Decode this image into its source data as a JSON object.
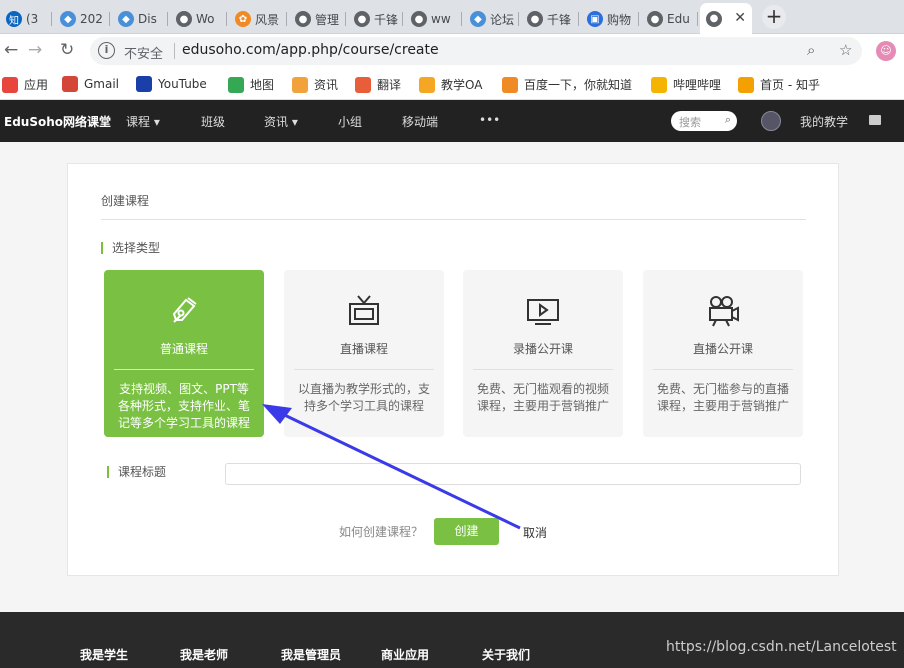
{
  "browser": {
    "tabs": [
      {
        "label": "(3 ",
        "icon": "zhihu-icon",
        "icon_text": "知",
        "color": "#0a66c2"
      },
      {
        "label": "202",
        "icon": "blog-icon",
        "icon_text": "◆",
        "color": "#4a90d9"
      },
      {
        "label": "Dis",
        "icon": "blog-icon",
        "icon_text": "◆",
        "color": "#4a90d9"
      },
      {
        "label": "Wo",
        "icon": "globe-icon",
        "icon_text": "●",
        "color": "#5f6368"
      },
      {
        "label": "风景",
        "icon": "paw-icon",
        "icon_text": "✿",
        "color": "#f08a24"
      },
      {
        "label": "管理",
        "icon": "globe-icon",
        "icon_text": "●",
        "color": "#5f6368"
      },
      {
        "label": "千锋",
        "icon": "globe-icon",
        "icon_text": "●",
        "color": "#5f6368"
      },
      {
        "label": "ww",
        "icon": "globe-icon",
        "icon_text": "●",
        "color": "#5f6368"
      },
      {
        "label": "论坛",
        "icon": "blog-icon",
        "icon_text": "◆",
        "color": "#4a90d9"
      },
      {
        "label": "千锋",
        "icon": "globe-icon",
        "icon_text": "●",
        "color": "#5f6368"
      },
      {
        "label": "购物",
        "icon": "cart-icon",
        "icon_text": "▣",
        "color": "#2a6fdb"
      },
      {
        "label": "Edu",
        "icon": "globe-icon",
        "icon_text": "●",
        "color": "#5f6368"
      },
      {
        "label": "",
        "icon": "globe-icon",
        "icon_text": "●",
        "color": "#5f6368",
        "active": true
      }
    ],
    "close_glyph": "✕",
    "newtab_glyph": "+",
    "back_glyph": "←",
    "forward_glyph": "→",
    "reload_glyph": "↻",
    "info_glyph": "i",
    "insecure": "不安全",
    "url": "edusoho.com/app.php/course/create",
    "zoom_glyph": "⌕",
    "star_glyph": "☆",
    "bookmarks": [
      {
        "label": "应用",
        "icon": "apps-icon",
        "color": "#e8453c"
      },
      {
        "label": "Gmail",
        "icon": "gmail-icon",
        "color": "#d44638"
      },
      {
        "label": "YouTube",
        "icon": "youtube-icon",
        "color": "#1a3fa8"
      },
      {
        "label": "地图",
        "icon": "maps-icon",
        "color": "#34a853"
      },
      {
        "label": "资讯",
        "icon": "news-icon",
        "color": "#f2a23a"
      },
      {
        "label": "翻译",
        "icon": "translate-icon",
        "color": "#e85d3a"
      },
      {
        "label": "教学OA",
        "icon": "oa-icon",
        "color": "#f5a623"
      },
      {
        "label": "百度一下，你就知道",
        "icon": "baidu-icon",
        "color": "#f08a24"
      },
      {
        "label": "哔哩哔哩",
        "icon": "bilibili-icon",
        "color": "#f4b400"
      },
      {
        "label": "首页 - 知乎",
        "icon": "zhihu-icon",
        "color": "#f4a000"
      }
    ]
  },
  "site": {
    "brand": "EduSoho网络课堂",
    "nav": [
      "课程 ▾",
      "班级",
      "资讯 ▾",
      "小组",
      "移动端",
      "•••"
    ],
    "search_placeholder": "搜索",
    "search_glyph": "⌕",
    "my_teaching": "我的教学"
  },
  "form": {
    "title": "创建课程",
    "type_label": "选择类型",
    "types": [
      {
        "name": "普通课程",
        "desc": "支持视频、图文、PPT等各种形式，支持作业、笔记等多个学习工具的课程",
        "selected": true
      },
      {
        "name": "直播课程",
        "desc": "以直播为教学形式的，支持多个学习工具的课程",
        "selected": false
      },
      {
        "name": "录播公开课",
        "desc": "免费、无门槛观看的视频课程，主要用于营销推广",
        "selected": false
      },
      {
        "name": "直播公开课",
        "desc": "免费、无门槛参与的直播课程，主要用于营销推广",
        "selected": false
      }
    ],
    "course_title_label": "课程标题",
    "course_title_value": "",
    "howto": "如何创建课程？",
    "create": "创建",
    "cancel": "取消"
  },
  "footer": {
    "links": [
      "我是学生",
      "我是老师",
      "我是管理员",
      "商业应用",
      "关于我们"
    ],
    "watermark": "https://blog.csdn.net/Lancelotest"
  },
  "annotation": {
    "color": "#3a3ae8"
  }
}
